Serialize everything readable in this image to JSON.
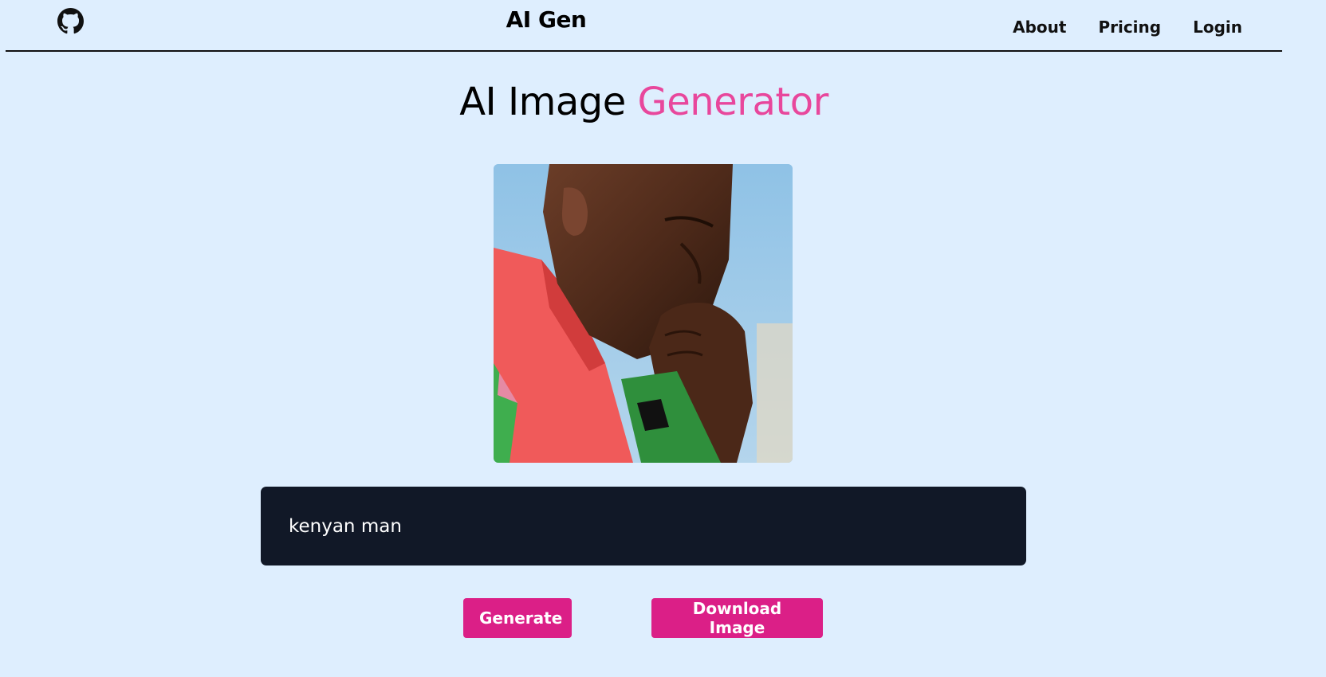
{
  "header": {
    "brand": "AI Gen",
    "github_icon": "github-icon",
    "nav": [
      {
        "label": "About"
      },
      {
        "label": "Pricing"
      },
      {
        "label": "Login"
      }
    ]
  },
  "hero": {
    "title_part1": "AI Image ",
    "title_part2": "Generator"
  },
  "generated_image": {
    "alt": "Generated image of a man in a red and green shirt, hand on chin, against blue sky"
  },
  "prompt": {
    "value": "kenyan man",
    "placeholder": ""
  },
  "actions": {
    "generate_label": "Generate",
    "download_label": "Download Image"
  },
  "colors": {
    "background": "#deeefe",
    "accent": "#e8479c",
    "button": "#db1f87",
    "input_bg": "#111827"
  }
}
